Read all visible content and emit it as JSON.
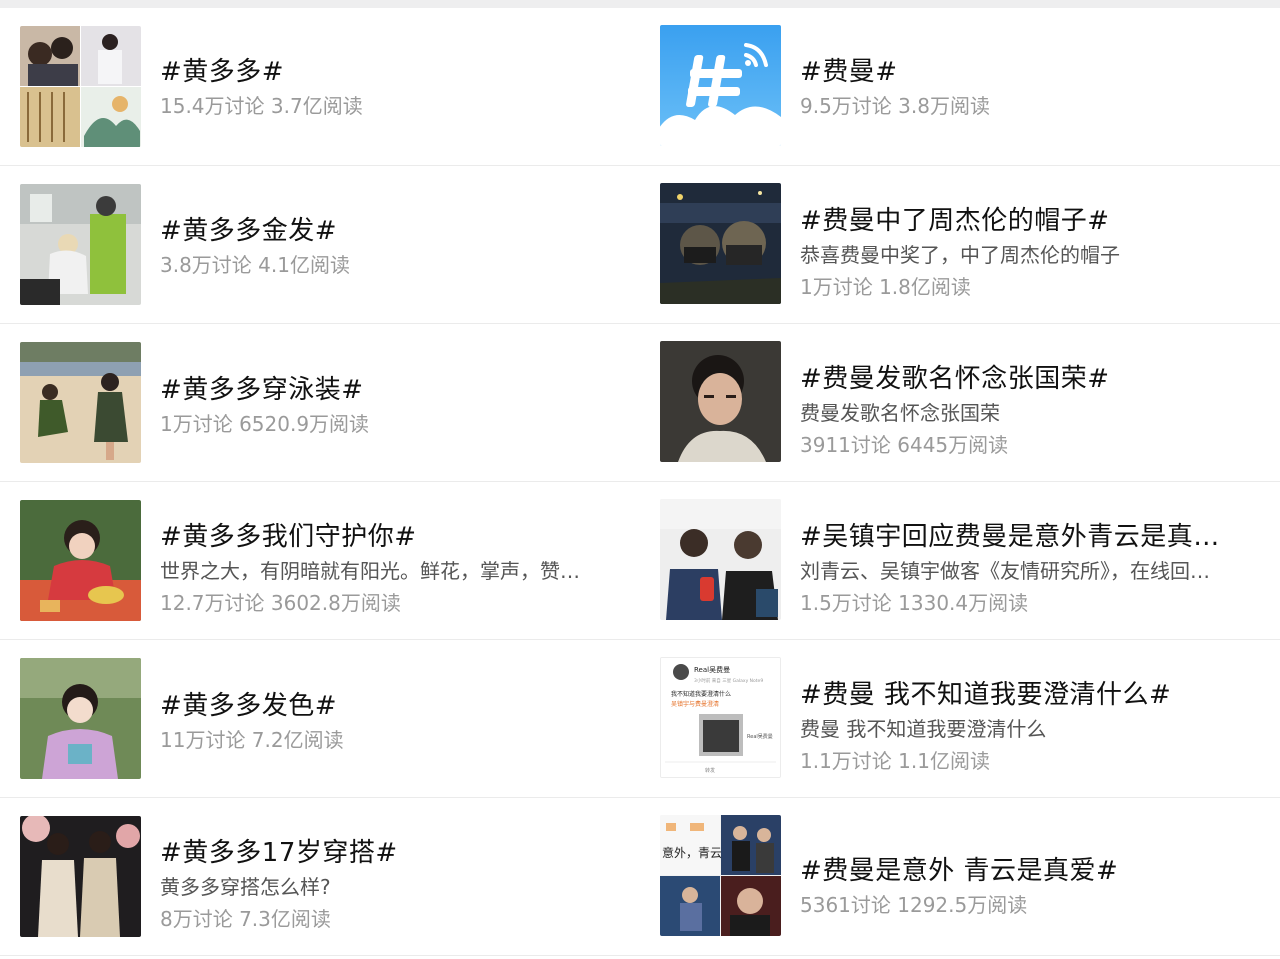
{
  "left_column": [
    {
      "title": "#黄多多#",
      "desc": "",
      "stats": "15.4万讨论 3.7亿阅读",
      "thumb": "collage-family-photo"
    },
    {
      "title": "#黄多多金发#",
      "desc": "",
      "stats": "3.8万讨论 4.1亿阅读",
      "thumb": "salon-photo"
    },
    {
      "title": "#黄多多穿泳装#",
      "desc": "",
      "stats": "1万讨论 6520.9万阅读",
      "thumb": "beach-photo"
    },
    {
      "title": "#黄多多我们守护你#",
      "desc": "世界之大，有阴暗就有阳光。鲜花，掌声，赞…",
      "stats": "12.7万讨论 3602.8万阅读",
      "thumb": "girl-red-jacket-photo"
    },
    {
      "title": "#黄多多发色#",
      "desc": "",
      "stats": "11万讨论 7.2亿阅读",
      "thumb": "girl-pink-shirt-photo"
    },
    {
      "title": "#黄多多17岁穿搭#",
      "desc": "黄多多穿搭怎么样?",
      "stats": "8万讨论 7.3亿阅读",
      "thumb": "two-girls-photo"
    }
  ],
  "right_column": [
    {
      "title": "#费曼#",
      "desc": "",
      "stats": "9.5万讨论 3.8万阅读",
      "thumb": "hashtag-cloud-icon"
    },
    {
      "title": "#费曼中了周杰伦的帽子#",
      "desc": "恭喜费曼中奖了，中了周杰伦的帽子",
      "stats": "1万讨论 1.8亿阅读",
      "thumb": "selfie-night-photo"
    },
    {
      "title": "#费曼发歌名怀念张国荣#",
      "desc": "费曼发歌名怀念张国荣",
      "stats": "3911讨论 6445万阅读",
      "thumb": "portrait-photo"
    },
    {
      "title": "#吴镇宇回应费曼是意外青云是真…",
      "desc": "刘青云、吴镇宇做客《友情研究所》，在线回…",
      "stats": "1.5万讨论 1330.4万阅读",
      "thumb": "two-men-event-photo"
    },
    {
      "title": "#费曼 我不知道我要澄清什么#",
      "desc": "费曼 我不知道我要澄清什么",
      "stats": "1.1万讨论 1.1亿阅读",
      "thumb": "weibo-post-screenshot",
      "post": {
        "user": "Real吴费曼",
        "meta": "3小时前 来自 三星 Galaxy Note9",
        "line1": "我不知道我要澄清什么",
        "line2": "吴镇宇与费曼澄清",
        "caption": "Real吴费曼",
        "action": "转发"
      }
    },
    {
      "title": "#费曼是意外 青云是真爱#",
      "desc": "",
      "stats": "5361讨论 1292.5万阅读",
      "thumb": "tv-collage-photo",
      "collage_text": "意外，青云"
    }
  ]
}
